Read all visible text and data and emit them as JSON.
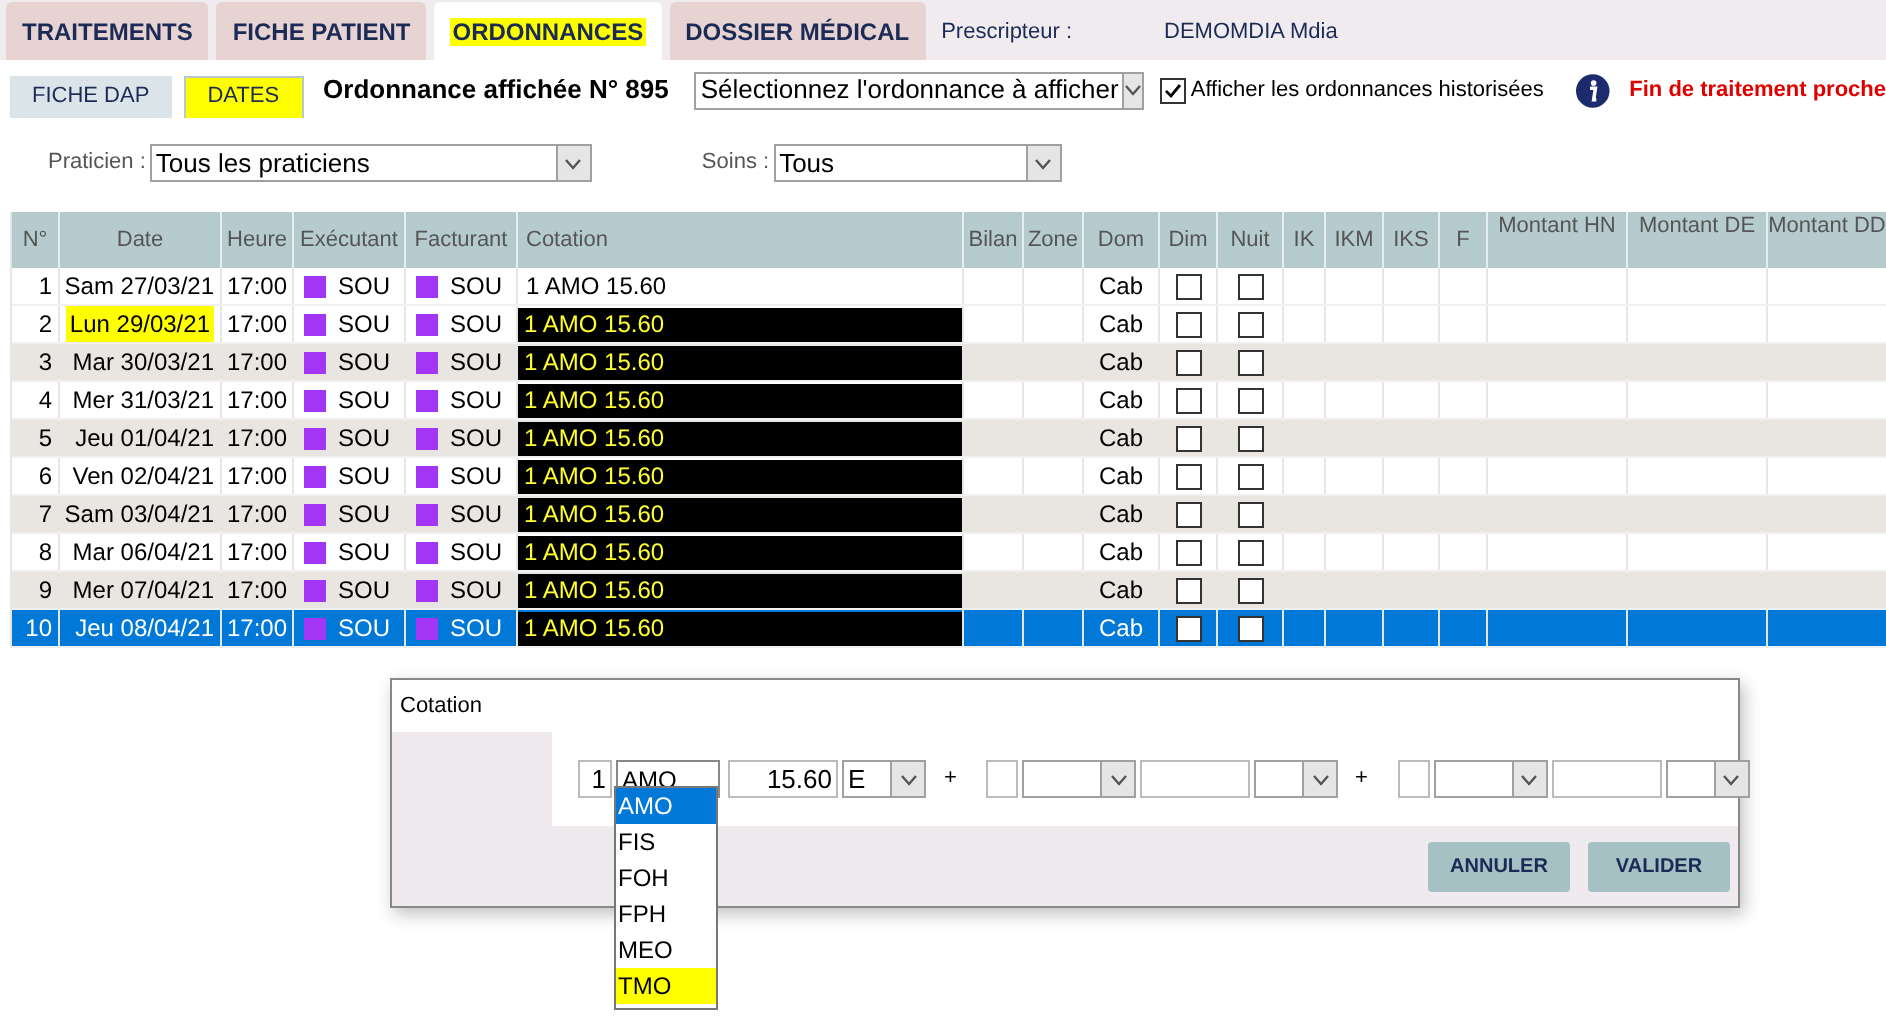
{
  "top_tabs": [
    {
      "label": "TRAITEMENTS",
      "selected": false,
      "highlighted": false
    },
    {
      "label": "FICHE PATIENT",
      "selected": false,
      "highlighted": false
    },
    {
      "label": "ORDONNANCES",
      "selected": true,
      "highlighted": true
    },
    {
      "label": "DOSSIER MÉDICAL",
      "selected": false,
      "highlighted": false
    }
  ],
  "prescripteur": {
    "label": "Prescripteur :",
    "value": "DEMOMDIA Mdia"
  },
  "sub_tabs": [
    {
      "label": "FICHE DAP",
      "selected": false,
      "highlighted": false
    },
    {
      "label": "DATES",
      "selected": true,
      "highlighted": true
    }
  ],
  "ordonnance_label": "Ordonnance affichée N° 895",
  "ordonnance_select": {
    "value": "Sélectionnez l'ordonnance à afficher"
  },
  "show_history": {
    "label": "Afficher les ordonnances historisées",
    "checked": true
  },
  "alert": "Fin de traitement proche",
  "filters": [
    {
      "label": "Praticien :",
      "value": "Tous les praticiens"
    },
    {
      "label": "Soins :",
      "value": "Tous"
    }
  ],
  "table": {
    "columns": [
      "N°",
      "Date",
      "Heure",
      "Exécutant",
      "Facturant",
      "Cotation",
      "Bilan",
      "Zone",
      "Dom",
      "Dim",
      "Nuit",
      "IK",
      "IKM",
      "IKS",
      "F",
      "Montant HN",
      "Montant DE",
      "Montant DD"
    ],
    "rows": [
      {
        "n": "1",
        "date": "Sam 27/03/21",
        "time": "17:00",
        "exec": "SOU",
        "fact": "SOU",
        "cotation": "1 AMO 15.60",
        "dom": "Cab",
        "dim": false,
        "nuit": false,
        "selected": false,
        "shaded": false,
        "date_highlighted": false,
        "cotation_highlighted": false
      },
      {
        "n": "2",
        "date": "Lun 29/03/21",
        "time": "17:00",
        "exec": "SOU",
        "fact": "SOU",
        "cotation": "1 AMO 15.60",
        "dom": "Cab",
        "dim": false,
        "nuit": false,
        "selected": false,
        "shaded": false,
        "date_highlighted": true,
        "cotation_highlighted": true
      },
      {
        "n": "3",
        "date": "Mar 30/03/21",
        "time": "17:00",
        "exec": "SOU",
        "fact": "SOU",
        "cotation": "1 AMO 15.60",
        "dom": "Cab",
        "dim": false,
        "nuit": false,
        "selected": false,
        "shaded": true,
        "date_highlighted": false,
        "cotation_highlighted": true
      },
      {
        "n": "4",
        "date": "Mer 31/03/21",
        "time": "17:00",
        "exec": "SOU",
        "fact": "SOU",
        "cotation": "1 AMO 15.60",
        "dom": "Cab",
        "dim": false,
        "nuit": false,
        "selected": false,
        "shaded": false,
        "date_highlighted": false,
        "cotation_highlighted": true
      },
      {
        "n": "5",
        "date": "Jeu 01/04/21",
        "time": "17:00",
        "exec": "SOU",
        "fact": "SOU",
        "cotation": "1 AMO 15.60",
        "dom": "Cab",
        "dim": false,
        "nuit": false,
        "selected": false,
        "shaded": true,
        "date_highlighted": false,
        "cotation_highlighted": true
      },
      {
        "n": "6",
        "date": "Ven 02/04/21",
        "time": "17:00",
        "exec": "SOU",
        "fact": "SOU",
        "cotation": "1 AMO 15.60",
        "dom": "Cab",
        "dim": false,
        "nuit": false,
        "selected": false,
        "shaded": false,
        "date_highlighted": false,
        "cotation_highlighted": true
      },
      {
        "n": "7",
        "date": "Sam 03/04/21",
        "time": "17:00",
        "exec": "SOU",
        "fact": "SOU",
        "cotation": "1 AMO 15.60",
        "dom": "Cab",
        "dim": false,
        "nuit": false,
        "selected": false,
        "shaded": true,
        "date_highlighted": false,
        "cotation_highlighted": true
      },
      {
        "n": "8",
        "date": "Mar 06/04/21",
        "time": "17:00",
        "exec": "SOU",
        "fact": "SOU",
        "cotation": "1 AMO 15.60",
        "dom": "Cab",
        "dim": false,
        "nuit": false,
        "selected": false,
        "shaded": false,
        "date_highlighted": false,
        "cotation_highlighted": true
      },
      {
        "n": "9",
        "date": "Mer 07/04/21",
        "time": "17:00",
        "exec": "SOU",
        "fact": "SOU",
        "cotation": "1 AMO 15.60",
        "dom": "Cab",
        "dim": false,
        "nuit": false,
        "selected": false,
        "shaded": true,
        "date_highlighted": false,
        "cotation_highlighted": true
      },
      {
        "n": "10",
        "date": "Jeu 08/04/21",
        "time": "17:00",
        "exec": "SOU",
        "fact": "SOU",
        "cotation": "1 AMO 15.60",
        "dom": "Cab",
        "dim": false,
        "nuit": false,
        "selected": true,
        "shaded": false,
        "date_highlighted": false,
        "cotation_highlighted": true
      }
    ]
  },
  "dialog": {
    "title": "Cotation",
    "quantity": "1",
    "code": "AMO",
    "amount": "15.60",
    "coefficient": "E",
    "plus_signs": [
      "+",
      "+"
    ],
    "code_options": [
      {
        "label": "AMO",
        "selected": true,
        "highlighted": false
      },
      {
        "label": "FIS",
        "selected": false,
        "highlighted": false
      },
      {
        "label": "FOH",
        "selected": false,
        "highlighted": false
      },
      {
        "label": "FPH",
        "selected": false,
        "highlighted": false
      },
      {
        "label": "MEO",
        "selected": false,
        "highlighted": false
      },
      {
        "label": "TMO",
        "selected": false,
        "highlighted": true
      }
    ],
    "buttons": [
      "ANNULER",
      "VALIDER"
    ]
  }
}
